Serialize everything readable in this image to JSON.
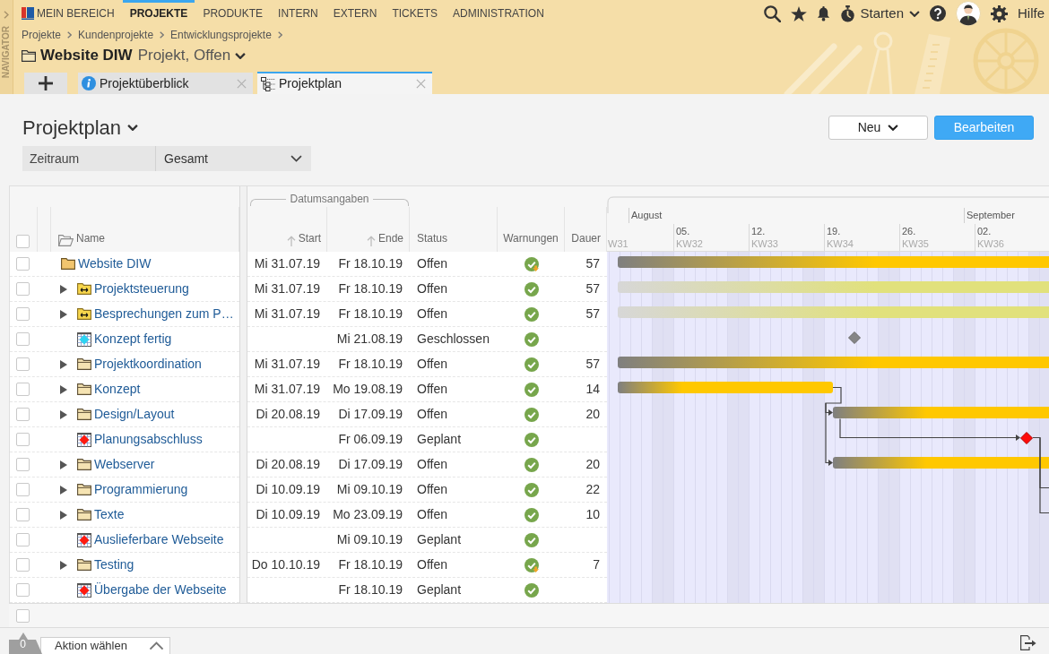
{
  "navigator": {
    "label": "NAVIGATOR"
  },
  "top_nav": [
    {
      "label": "MEIN BEREICH",
      "kind": "home",
      "selected": false
    },
    {
      "label": "PROJEKTE",
      "kind": "section",
      "selected": true
    },
    {
      "label": "PRODUKTE",
      "kind": "section",
      "selected": false
    },
    {
      "label": "INTERN",
      "kind": "section",
      "selected": false
    },
    {
      "label": "EXTERN",
      "kind": "section",
      "selected": false
    },
    {
      "label": "TICKETS",
      "kind": "section",
      "selected": false
    },
    {
      "label": "ADMINISTRATION",
      "kind": "section",
      "selected": false
    }
  ],
  "toolbar": {
    "timer": "Starten",
    "help": "Hilfe"
  },
  "breadcrumbs": [
    "Projekte",
    "Kundenprojekte",
    "Entwicklungsprojekte"
  ],
  "object": {
    "name": "Website DIW",
    "subtitle": "Projekt, Offen"
  },
  "tabs": [
    {
      "label": "Projektüberblick",
      "kind": "overview",
      "selected": false
    },
    {
      "label": "Projektplan",
      "kind": "plan",
      "selected": true
    }
  ],
  "view": {
    "title": "Projektplan",
    "buttons": [
      {
        "label": "Neu",
        "kind": "menu"
      },
      {
        "label": "Bearbeiten",
        "kind": "primary"
      }
    ]
  },
  "filter": {
    "label": "Zeitraum",
    "value": "Gesamt"
  },
  "table": {
    "select_all": {
      "checked": false
    },
    "column_group": "Datumsangaben",
    "columns": [
      {
        "label": "Name",
        "kind": "name"
      },
      {
        "label": "Start",
        "kind": "sort"
      },
      {
        "label": "Ende",
        "kind": "sort"
      },
      {
        "label": "Status",
        "kind": "text"
      },
      {
        "label": "Warnungen",
        "kind": "text"
      },
      {
        "label": "Dauer",
        "kind": "text"
      }
    ],
    "rows": [
      {
        "name": "Website DIW",
        "kind": "project",
        "checked": false,
        "start": "Mi 31.07.19",
        "end": "Fr 18.10.19",
        "status": "Offen",
        "warning": true,
        "duration": "57",
        "children": [
          {
            "name": "Projektsteuerung",
            "kind": "recurring",
            "checked": false,
            "expanded": false,
            "start": "Mi 31.07.19",
            "end": "Fr 18.10.19",
            "status": "Offen",
            "warning": false,
            "duration": "57"
          },
          {
            "name": "Besprechungen zum P…",
            "kind": "recurring",
            "checked": false,
            "expanded": false,
            "start": "Mi 31.07.19",
            "end": "Fr 18.10.19",
            "status": "Offen",
            "warning": false,
            "duration": "57"
          },
          {
            "name": "Konzept fertig",
            "kind": "milestone",
            "reached": true,
            "checked": false,
            "end": "Mi 21.08.19",
            "status": "Geschlossen",
            "warning": false
          },
          {
            "name": "Projektkoordination",
            "kind": "phase",
            "checked": false,
            "expanded": false,
            "start": "Mi 31.07.19",
            "end": "Fr 18.10.19",
            "status": "Offen",
            "warning": false,
            "duration": "57"
          },
          {
            "name": "Konzept",
            "kind": "phase",
            "checked": false,
            "expanded": false,
            "start": "Mi 31.07.19",
            "end": "Mo 19.08.19",
            "status": "Offen",
            "warning": false,
            "duration": "14"
          },
          {
            "name": "Design/Layout",
            "kind": "phase",
            "checked": false,
            "expanded": false,
            "start": "Di 20.08.19",
            "end": "Di 17.09.19",
            "status": "Offen",
            "warning": false,
            "duration": "20"
          },
          {
            "name": "Planungsabschluss",
            "kind": "milestone",
            "reached": false,
            "checked": false,
            "end": "Fr 06.09.19",
            "status": "Geplant",
            "warning": false
          },
          {
            "name": "Webserver",
            "kind": "phase",
            "checked": false,
            "expanded": false,
            "start": "Di 20.08.19",
            "end": "Di 17.09.19",
            "status": "Offen",
            "warning": false,
            "duration": "20"
          },
          {
            "name": "Programmierung",
            "kind": "phase",
            "checked": false,
            "expanded": false,
            "start": "Di 10.09.19",
            "end": "Mi 09.10.19",
            "status": "Offen",
            "warning": false,
            "duration": "22"
          },
          {
            "name": "Texte",
            "kind": "phase",
            "checked": false,
            "expanded": false,
            "start": "Di 10.09.19",
            "end": "Mo 23.09.19",
            "status": "Offen",
            "warning": false,
            "duration": "10"
          },
          {
            "name": "Auslieferbare Webseite",
            "kind": "milestone",
            "reached": false,
            "checked": false,
            "end": "Mi 09.10.19",
            "status": "Geplant",
            "warning": false
          },
          {
            "name": "Testing",
            "kind": "phase",
            "checked": false,
            "expanded": false,
            "start": "Do 10.10.19",
            "end": "Fr 18.10.19",
            "status": "Offen",
            "warning": true,
            "duration": "7"
          },
          {
            "name": "Übergabe der Webseite",
            "kind": "milestone",
            "reached": false,
            "checked": false,
            "end": "Fr 18.10.19",
            "status": "Geplant",
            "warning": false
          }
        ]
      }
    ],
    "footer": {
      "checked": false
    }
  },
  "gantt": {
    "months": [
      "August",
      "September"
    ],
    "weeks": [
      {
        "week": "W31"
      },
      {
        "day": "05.",
        "week": "KW32"
      },
      {
        "day": "12.",
        "week": "KW33"
      },
      {
        "day": "19.",
        "week": "KW34"
      },
      {
        "day": "26.",
        "week": "KW35"
      },
      {
        "day": "02.",
        "week": "KW36"
      }
    ]
  },
  "action_bar": {
    "count": "0",
    "action": "Aktion wählen"
  }
}
